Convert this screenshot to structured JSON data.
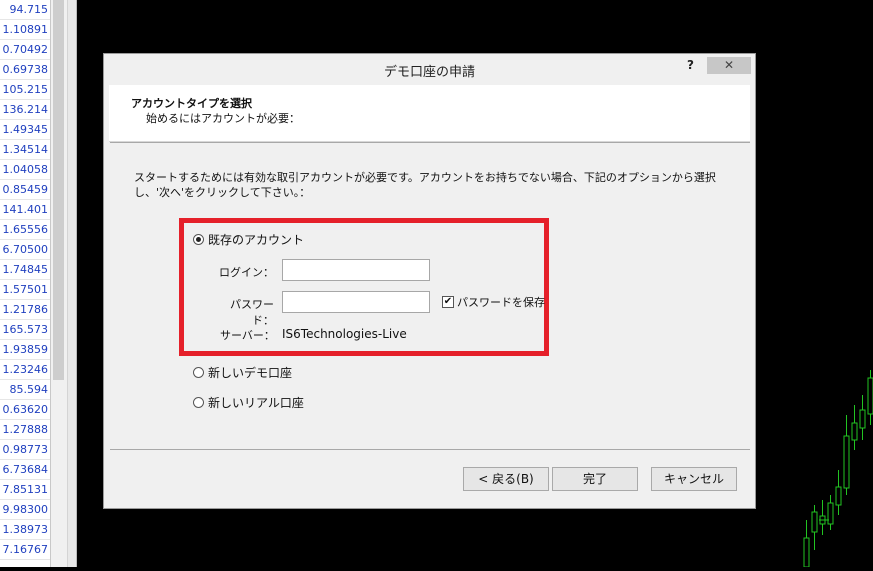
{
  "price_list": [
    "94.715",
    "1.10891",
    "0.70492",
    "0.69738",
    "105.215",
    "136.214",
    "1.49345",
    "1.34514",
    "1.04058",
    "0.85459",
    "141.401",
    "1.65556",
    "6.70500",
    "1.74845",
    "1.57501",
    "1.21786",
    "165.573",
    "1.93859",
    "1.23246",
    "85.594",
    "0.63620",
    "1.27888",
    "0.98773",
    "6.73684",
    "7.85131",
    "9.98300",
    "1.38973",
    "7.16767"
  ],
  "dialog": {
    "title": "デモ口座の申請",
    "help": "?",
    "close": "✕",
    "header_title": "アカウントタイプを選択",
    "header_subtitle": "始めるにはアカウントが必要：",
    "intro": "スタートするためには有効な取引アカウントが必要です。アカウントをお持ちでない場合、下記のオプションから選択し、'次へ'をクリックして下さい。：",
    "options": {
      "existing": "既存のアカウント",
      "new_demo": "新しいデモ口座",
      "new_real": "新しいリアル口座"
    },
    "login_label": "ログイン：",
    "login_value": "",
    "password_label": "パスワード：",
    "password_value": "",
    "save_password_label": "パスワードを保存",
    "save_password_checked": true,
    "server_label": "サーバー：",
    "server_value": "IS6Technologies-Live",
    "buttons": {
      "back": "< 戻る(B)",
      "finish": "完了",
      "cancel": "キャンセル"
    }
  },
  "colors": {
    "highlight": "#e5202a",
    "candle": "#22c422",
    "price_text": "#1f3fbf"
  }
}
